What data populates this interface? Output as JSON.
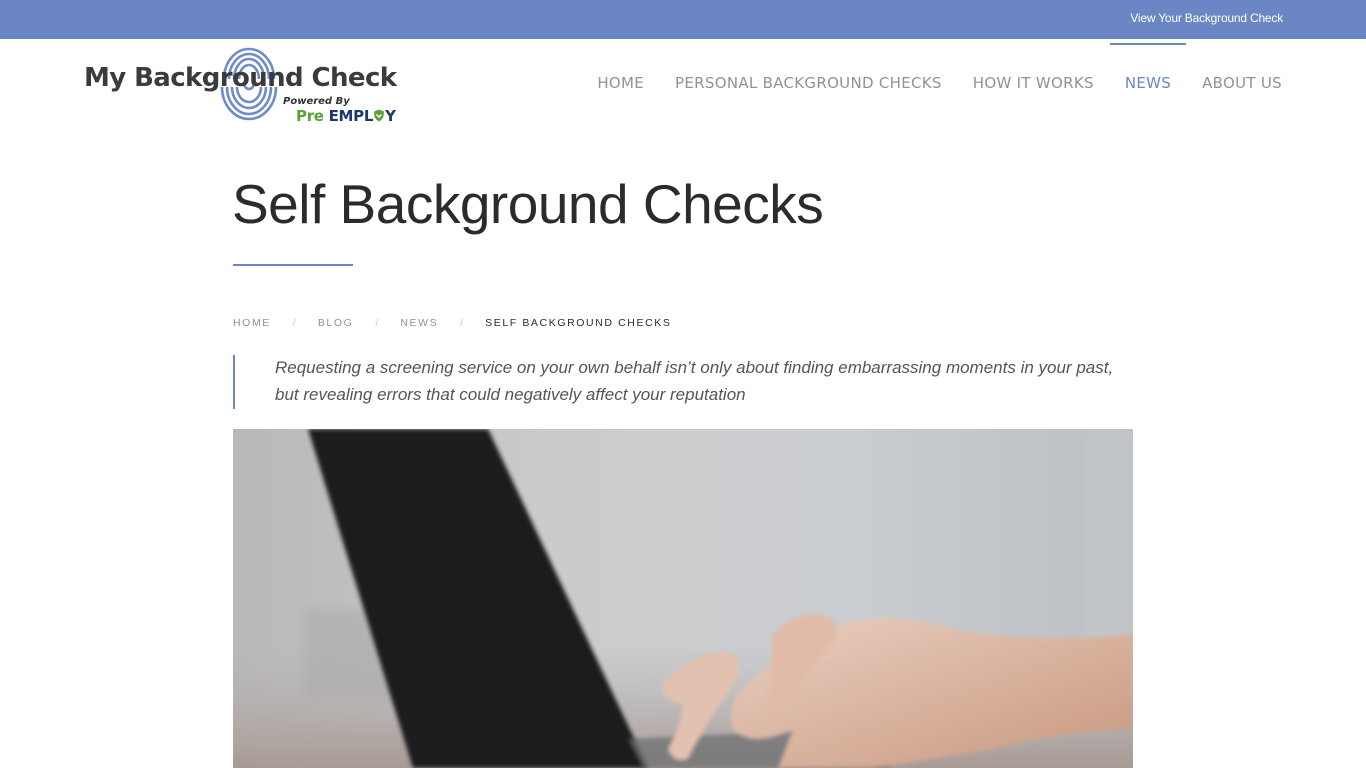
{
  "topbar": {
    "link_label": "View Your Background Check"
  },
  "logo": {
    "title": "My Background Check",
    "powered_by": "Powered By",
    "brand_pre": "Pre",
    "brand_employ": "EMPL",
    "brand_employ_end": "Y"
  },
  "nav": {
    "items": [
      {
        "label": "HOME"
      },
      {
        "label": "PERSONAL BACKGROUND CHECKS"
      },
      {
        "label": "HOW IT WORKS"
      },
      {
        "label": "NEWS",
        "active": true
      },
      {
        "label": "ABOUT US"
      }
    ]
  },
  "page": {
    "title": "Self Background Checks"
  },
  "breadcrumb": {
    "items": [
      "HOME",
      "BLOG",
      "NEWS",
      "SELF BACKGROUND CHECKS"
    ],
    "separator": "/"
  },
  "quote": {
    "text": "Requesting a screening service on your own behalf isn’t only about finding embarrassing moments in your past, but revealing errors that could negatively affect your reputation"
  },
  "hero": {
    "alt": "Hands typing on a laptop keyboard"
  },
  "colors": {
    "accent": "#6a86c4",
    "title": "#2b2b2b",
    "nav_text": "#8f9299",
    "brand_green": "#5aa23a",
    "brand_navy": "#1f3a68"
  }
}
